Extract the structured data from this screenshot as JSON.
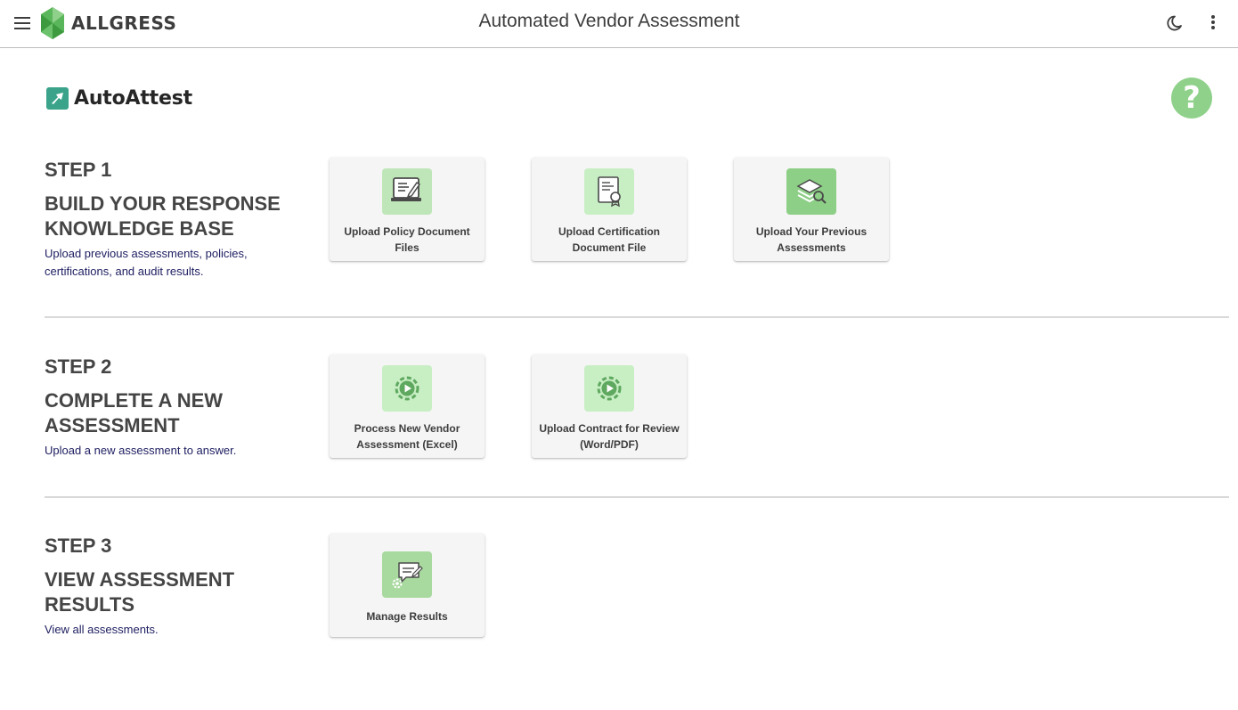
{
  "header": {
    "brand_name": "ALLGRESS",
    "title": "Automated Vendor Assessment",
    "menu_icon": "hamburger-menu-icon",
    "theme_icon": "moon-icon",
    "more_icon": "more-vert-icon"
  },
  "product": {
    "name": "AutoAttest",
    "help_label": "?"
  },
  "colors": {
    "brand_green": "#4caf50",
    "help_green": "#8fd18a",
    "icon_bg_light": "#c8efc4",
    "icon_bg_mid": "#a8d99f",
    "description_text": "#202063"
  },
  "steps": [
    {
      "label": "STEP 1",
      "title": "BUILD YOUR RESPONSE KNOWLEDGE BASE",
      "description": "Upload previous assessments, policies, certifications, and audit results.",
      "cards": [
        {
          "label": "Upload Policy Document Files",
          "icon": "policy-document-icon"
        },
        {
          "label": "Upload Certification Document File",
          "icon": "certificate-icon"
        },
        {
          "label": "Upload Your Previous Assessments",
          "icon": "layers-search-icon"
        }
      ]
    },
    {
      "label": "STEP 2",
      "title": "COMPLETE A NEW ASSESSMENT",
      "description": "Upload a new assessment to answer.",
      "cards": [
        {
          "label": "Process New Vendor Assessment (Excel)",
          "icon": "process-gear-icon"
        },
        {
          "label": "Upload Contract for Review (Word/PDF)",
          "icon": "process-gear-icon"
        }
      ]
    },
    {
      "label": "STEP 3",
      "title": "VIEW ASSESSMENT RESULTS",
      "description": "View all assessments.",
      "cards": [
        {
          "label": "Manage Results",
          "icon": "manage-results-icon"
        }
      ]
    }
  ]
}
